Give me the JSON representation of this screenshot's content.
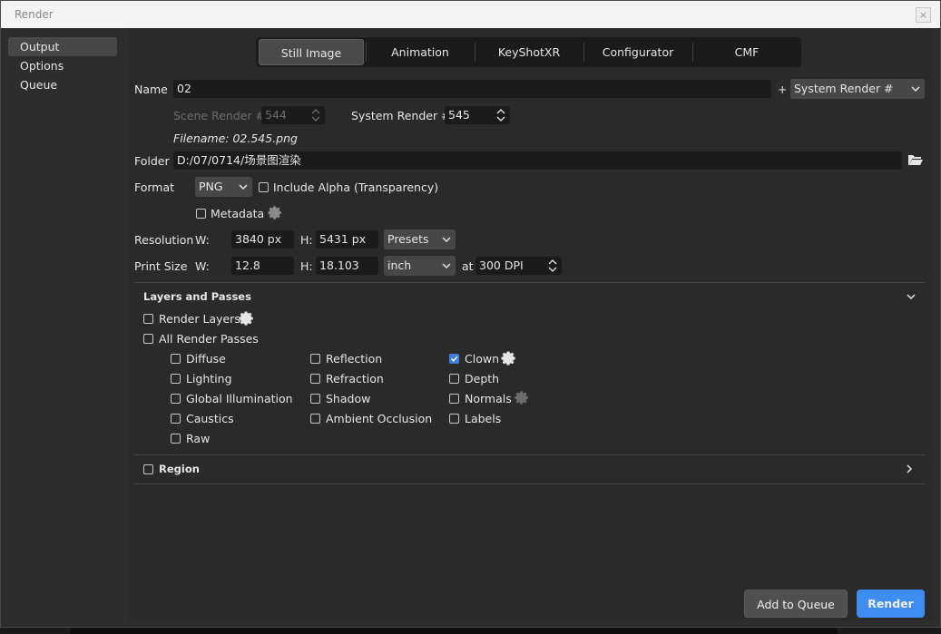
{
  "window": {
    "title": "Render",
    "close_glyph": "×"
  },
  "sidebar": {
    "items": [
      "Output",
      "Options",
      "Queue"
    ],
    "active": "Output"
  },
  "tabs": [
    "Still Image",
    "Animation",
    "KeyShotXR",
    "Configurator",
    "CMF"
  ],
  "output": {
    "name_label": "Name",
    "name_value": "02",
    "plus": "+",
    "suffix_select": "System Render #",
    "scene_render_label": "Scene Render #",
    "scene_render_value": "544",
    "system_render_label": "System Render #",
    "system_render_value": "545",
    "filename": "Filename: 02.545.png",
    "folder_label": "Folder",
    "folder_value": "D:/07/0714/场景图渲染",
    "format_label": "Format",
    "format_value": "PNG",
    "include_alpha_label": "Include Alpha (Transparency)",
    "metadata_label": "Metadata",
    "resolution_label": "Resolution",
    "w_label": "W:",
    "h_label": "H:",
    "res_w": "3840 px",
    "res_h": "5431 px",
    "presets_label": "Presets",
    "print_size_label": "Print Size",
    "print_w": "12.8",
    "print_h": "18.103",
    "unit_value": "inch",
    "at_label": "at",
    "dpi_value": "300 DPI"
  },
  "layers": {
    "header": "Layers and Passes",
    "render_layers": "Render Layers",
    "all_passes": "All Render Passes",
    "col1": [
      "Diffuse",
      "Lighting",
      "Global Illumination",
      "Caustics",
      "Raw"
    ],
    "col2": [
      "Reflection",
      "Refraction",
      "Shadow",
      "Ambient Occlusion"
    ],
    "col3": [
      "Clown",
      "Depth",
      "Normals",
      "Labels"
    ],
    "checked": [
      "Clown"
    ]
  },
  "region": {
    "header": "Region"
  },
  "actions": {
    "add_to_queue": "Add to Queue",
    "render": "Render"
  },
  "colors": {
    "accent": "#3d8ef0",
    "checkbox_checked": "#3b7fe0",
    "panel": "#2a2a2a",
    "field": "#1b1b1b"
  }
}
